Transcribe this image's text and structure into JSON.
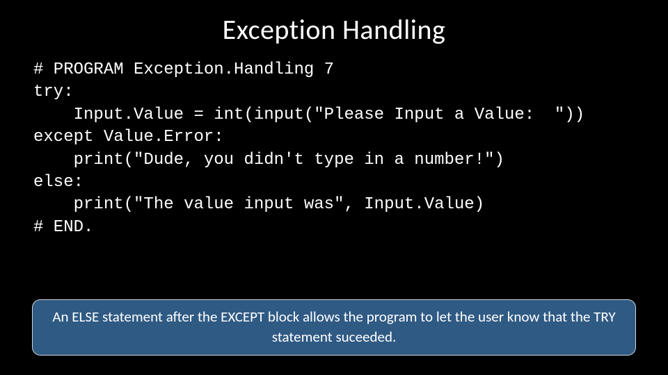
{
  "title": "Exception Handling",
  "code": {
    "line1": "# PROGRAM Exception.Handling 7",
    "line2": "try:",
    "line3": "    Input.Value = int(input(\"Please Input a Value:  \"))",
    "line4": "except Value.Error:",
    "line5": "    print(\"Dude, you didn't type in a number!\")",
    "line6": "else:",
    "line7": "    print(\"The value input was\", Input.Value)",
    "line8": "# END."
  },
  "callout": "An ELSE statement after the EXCEPT block allows the program to let the user know that the TRY statement suceeded."
}
